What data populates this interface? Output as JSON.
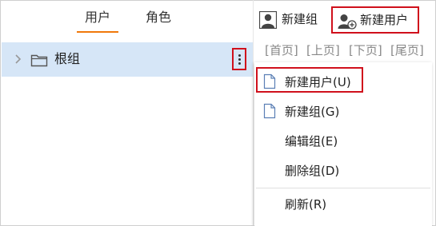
{
  "tabs": {
    "users": "用户",
    "roles": "角色"
  },
  "tree": {
    "root_label": "根组"
  },
  "toolbar": {
    "new_group": "新建组",
    "new_user": "新建用户"
  },
  "pager": {
    "first": "[首页]",
    "prev": "[上页]",
    "next": "[下页]",
    "last": "[尾页]"
  },
  "menu": {
    "new_user": "新建用户(U)",
    "new_group": "新建组(G)",
    "edit_group": "编辑组(E)",
    "delete_group": "删除组(D)",
    "refresh": "刷新(R)"
  },
  "colors": {
    "accent_underline": "#f0780a",
    "highlight_box": "#d0101c",
    "selected_row": "#d6e6f7"
  }
}
